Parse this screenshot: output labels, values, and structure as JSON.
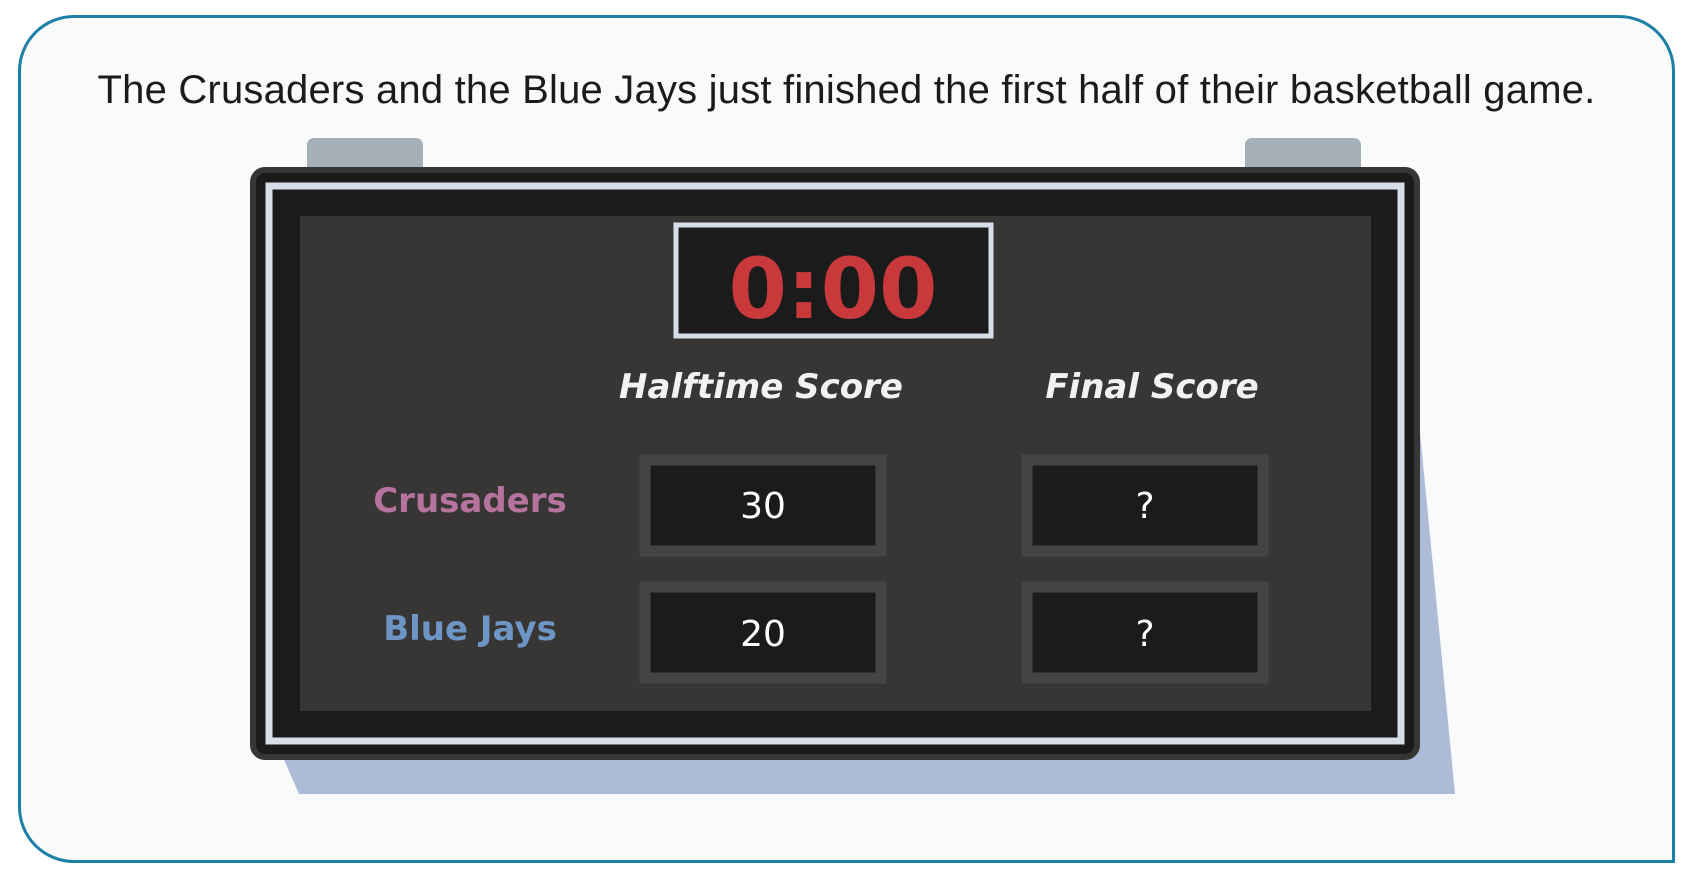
{
  "prompt": {
    "text": "The Crusaders and the Blue Jays just finished the first half of their basketball game."
  },
  "scoreboard": {
    "clock": "0:00",
    "column_headers": {
      "halftime": "Halftime Score",
      "final": "Final Score"
    },
    "teams": [
      {
        "name": "Crusaders",
        "color": "#b5739d",
        "halftime": "30",
        "final": "?"
      },
      {
        "name": "Blue Jays",
        "color": "#6d95c6",
        "halftime": "20",
        "final": "?"
      }
    ]
  },
  "colors": {
    "card_border": "#1c7fa6",
    "card_bg": "#f9fafa",
    "board_frame": "#1b1b1b",
    "board_panel": "#383635",
    "board_trim": "#d7dee8",
    "board_shadow": "#adbcd6",
    "mount_tabs": "#a5b0b8",
    "clock_text": "#c9393c",
    "score_box_border": "#444444",
    "score_box_fill": "#1b1b1b",
    "header_text": "#f2f2f2"
  }
}
